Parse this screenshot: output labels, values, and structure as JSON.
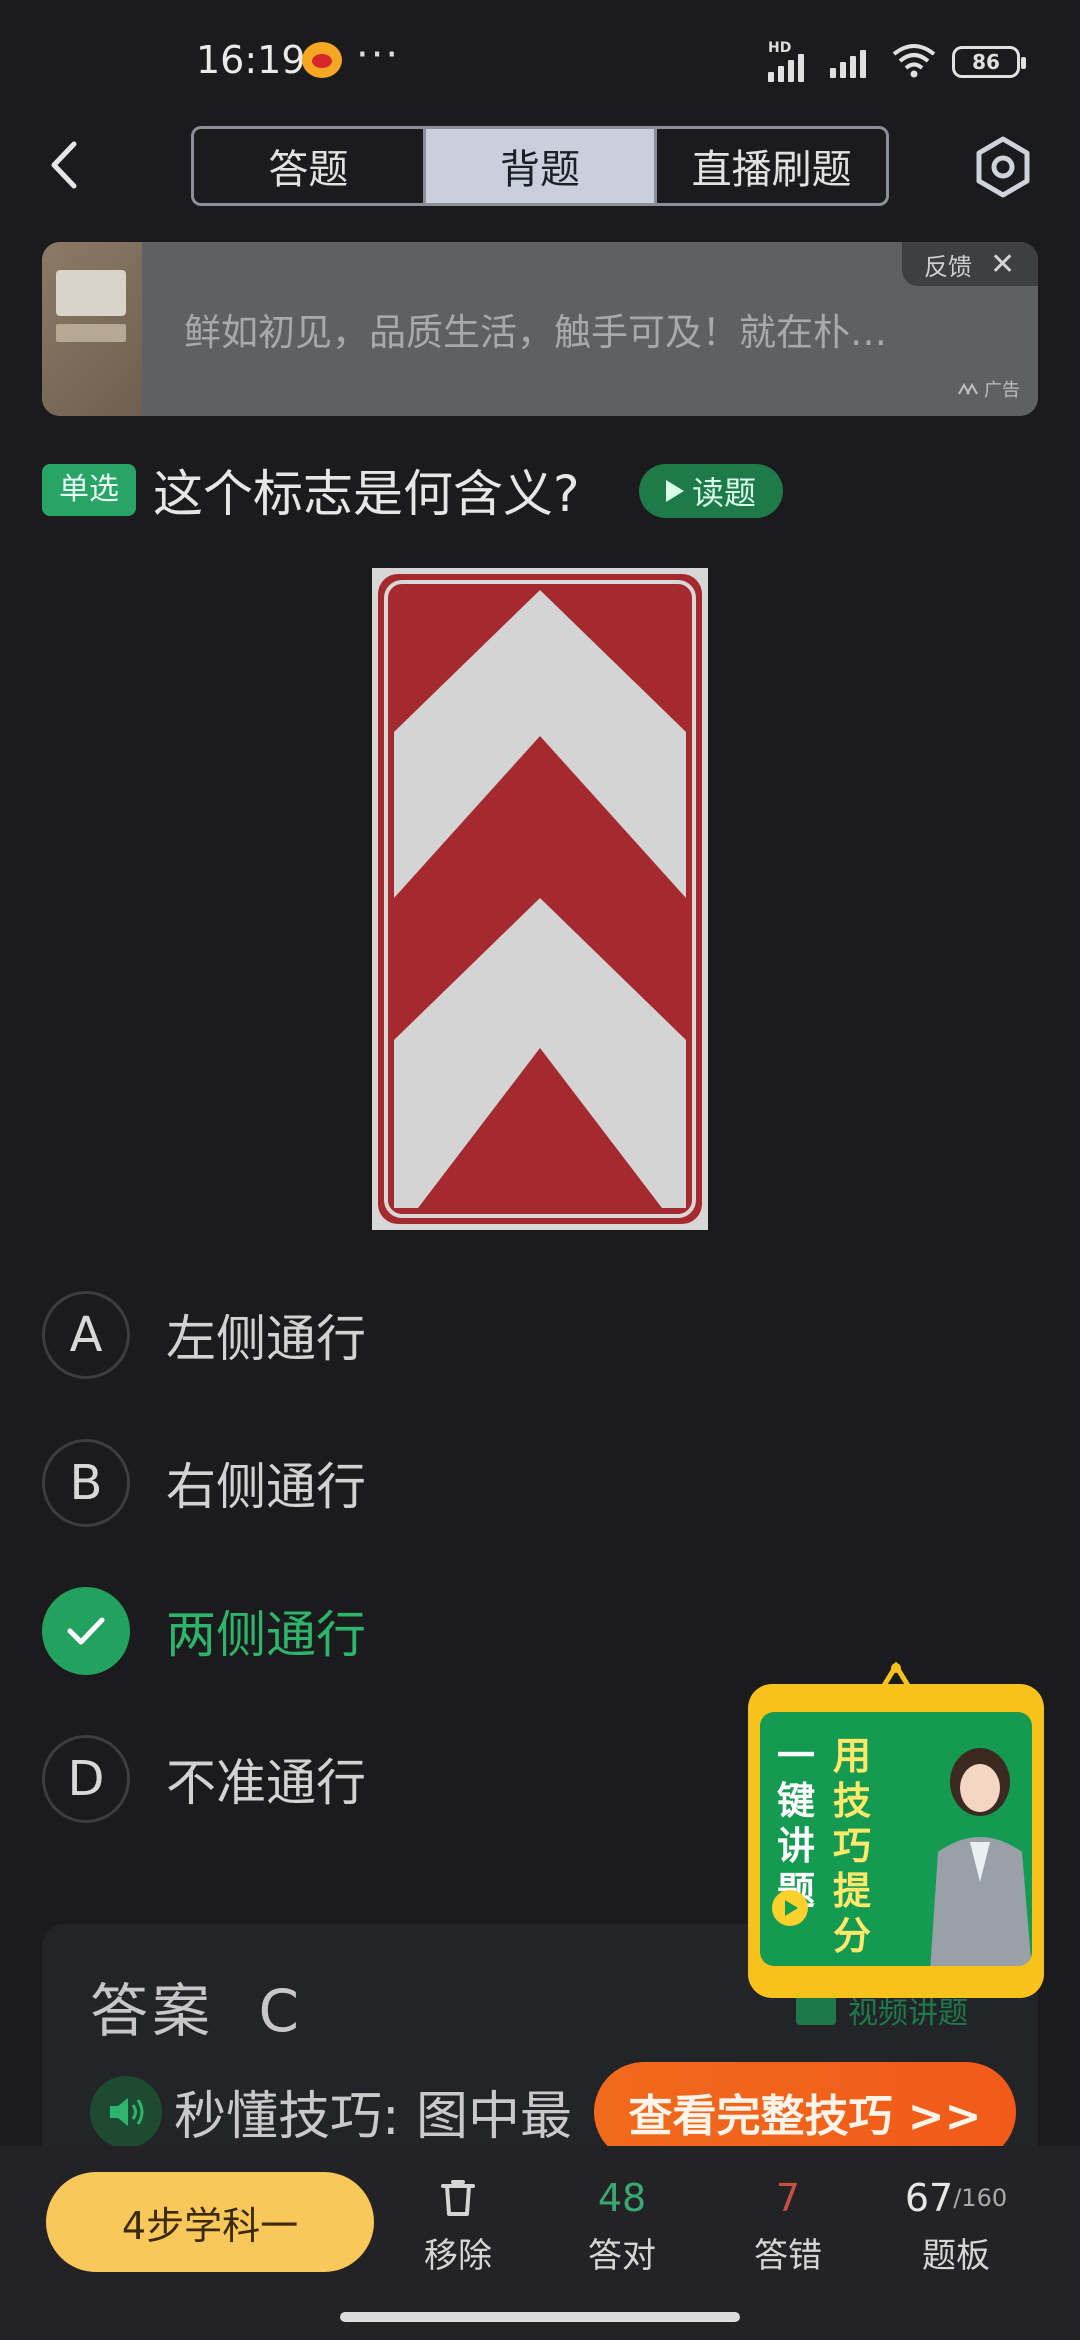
{
  "status_bar": {
    "time": "16:19",
    "more": "···",
    "hd": "HD",
    "battery": "86"
  },
  "header": {
    "tabs": [
      {
        "label": "答题",
        "active": false
      },
      {
        "label": "背题",
        "active": true
      },
      {
        "label": "直播刷题",
        "active": false
      }
    ]
  },
  "ad": {
    "text": "鲜如初见，品质生活，触手可及！就在朴…",
    "feedback": "反馈",
    "close": "✕",
    "label": "广告"
  },
  "question": {
    "type": "单选",
    "text": "这个标志是何含义?",
    "read_button": "读题"
  },
  "options": [
    {
      "letter": "A",
      "text": "左侧通行",
      "correct": false
    },
    {
      "letter": "B",
      "text": "右侧通行",
      "correct": false
    },
    {
      "letter": "C",
      "text": "两侧通行",
      "correct": true
    },
    {
      "letter": "D",
      "text": "不准通行",
      "correct": false
    }
  ],
  "answer": {
    "title": "答案",
    "value": "C",
    "video_explain": "视频讲题",
    "tip_text": "秒懂技巧: 图中最",
    "full_tip_button": "查看完整技巧 >>"
  },
  "promo": {
    "col1": "一键讲题",
    "col2": "用技巧提分"
  },
  "bottom_bar": {
    "study_button": "4步学科一",
    "remove_label": "移除",
    "correct_count": "48",
    "correct_label": "答对",
    "wrong_count": "7",
    "wrong_label": "答错",
    "board_current": "67",
    "board_total": "/160",
    "board_label": "题板"
  },
  "colors": {
    "accent_green": "#27a466",
    "promo_yellow": "#f8c21c",
    "orange_button": "#f06a1c",
    "study_button": "#f8c85a",
    "wrong_red": "#c94f45"
  }
}
